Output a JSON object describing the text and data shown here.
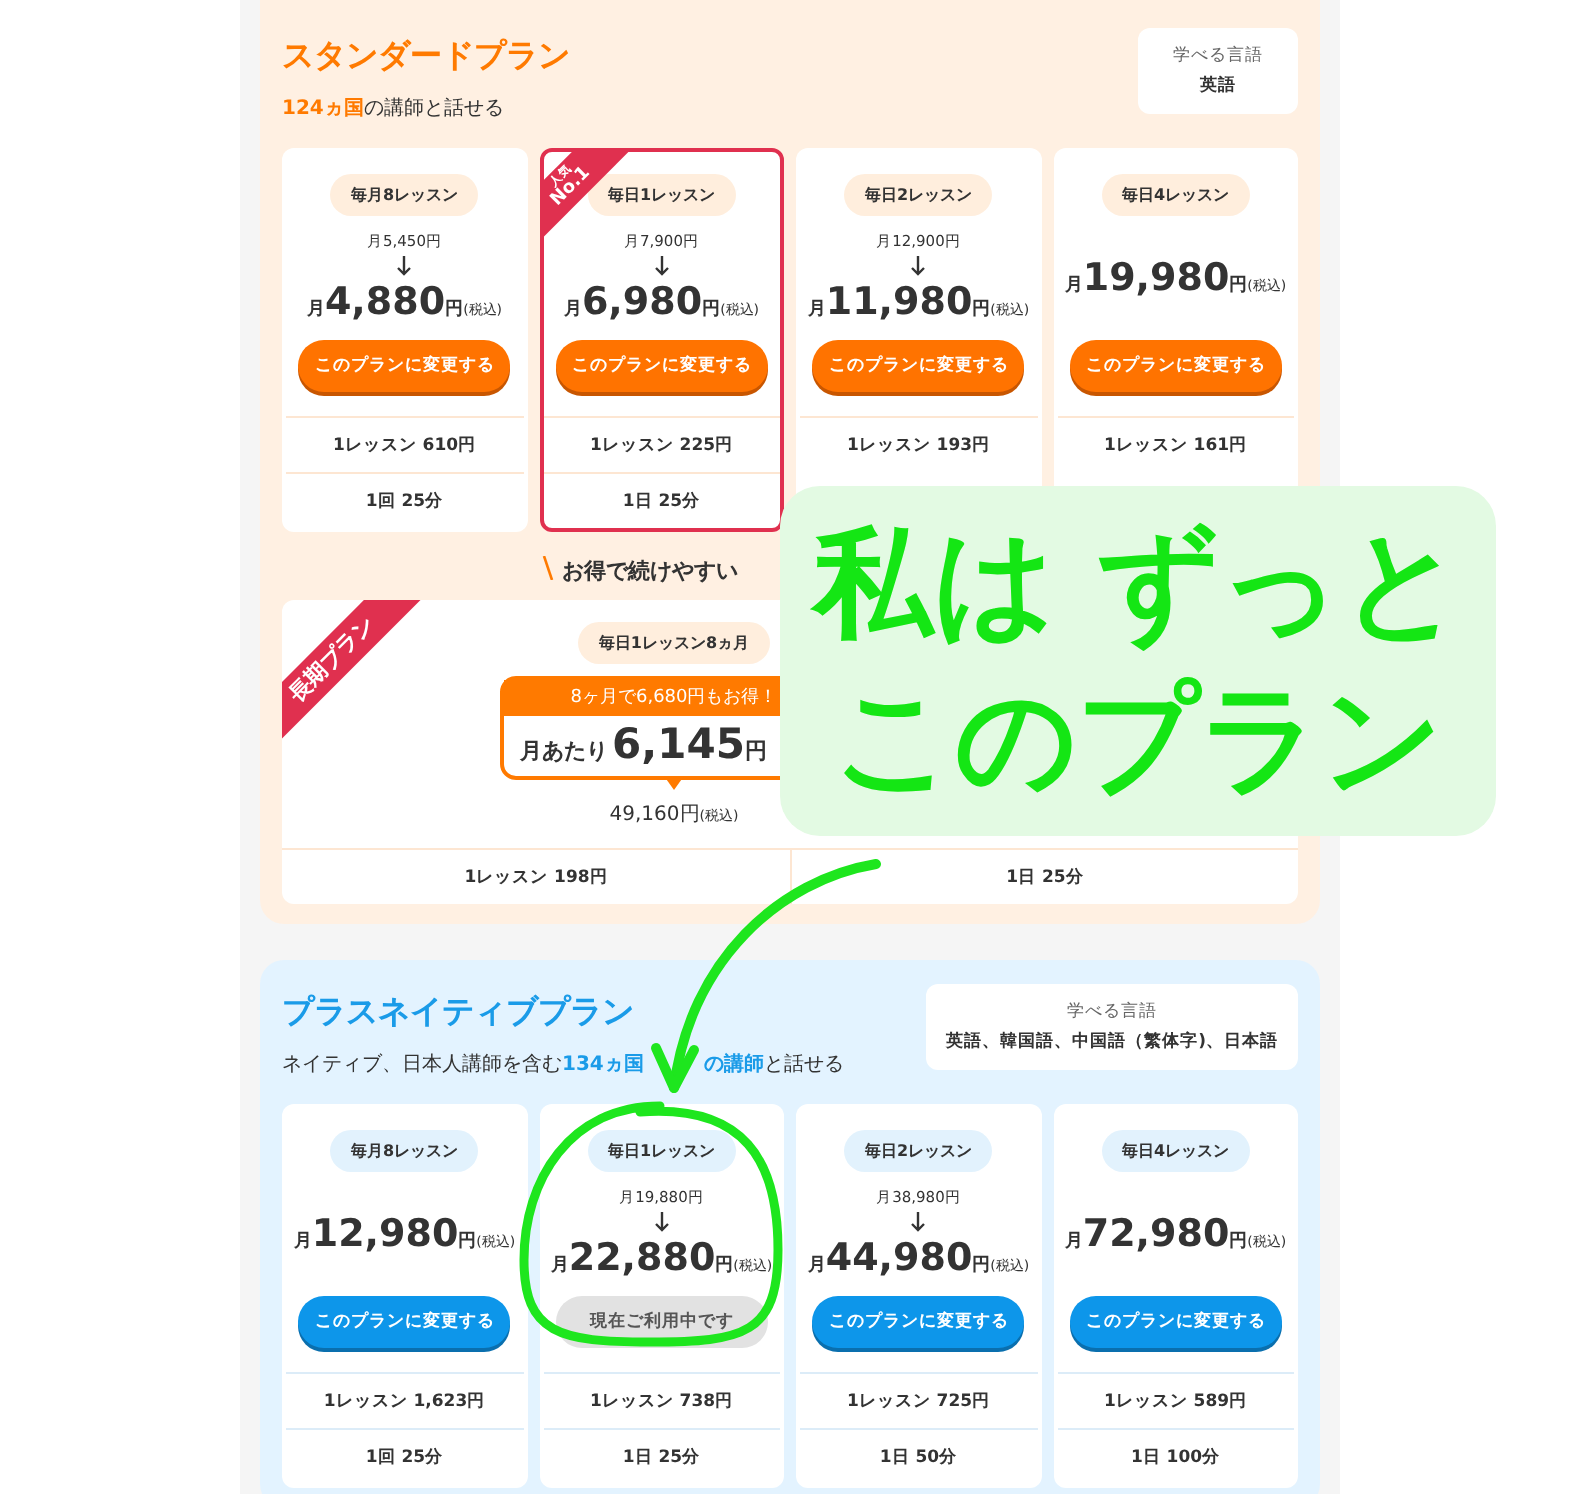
{
  "standard_plan": {
    "kind": "standard",
    "title": "スタンダードプラン",
    "subtitle": "**124ヵ国**の講師と話せる",
    "languages": {
      "label": "学べる言語",
      "value": "英語"
    },
    "plans": [
      {
        "tag": "毎月8レッスン",
        "original_price": "月5,450円",
        "prefix": "月",
        "amount": "4,880",
        "unit": "円",
        "tax": "(税込)",
        "button": "このプランに変更する",
        "current": false,
        "highlighted": false,
        "rows": [
          "1レッスン 610円",
          "1回 25分"
        ]
      },
      {
        "tag": "毎日1レッスン",
        "badge_small": "人気",
        "badge": "No.1",
        "original_price": "月7,900円",
        "prefix": "月",
        "amount": "6,980",
        "unit": "円",
        "tax": "(税込)",
        "button": "このプランに変更する",
        "current": false,
        "highlighted": true,
        "rows": [
          "1レッスン 225円",
          "1日 25分"
        ]
      },
      {
        "tag": "毎日2レッスン",
        "original_price": "月12,900円",
        "prefix": "月",
        "amount": "11,980",
        "unit": "円",
        "tax": "(税込)",
        "button": "このプランに変更する",
        "current": false,
        "highlighted": false,
        "rows": [
          "1レッスン 193円"
        ]
      },
      {
        "tag": "毎日4レッスン",
        "prefix": "月",
        "amount": "19,980",
        "unit": "円",
        "tax": "(税込)",
        "button": "このプランに変更する",
        "current": false,
        "highlighted": false,
        "rows": [
          "1レッスン 161円"
        ]
      }
    ],
    "long_term": {
      "heading": "お得で続けやすい",
      "ribbon": "長期プラン",
      "tag": "毎日1レッスン8ヵ月",
      "bubble": "8ヶ月で6,680円もお得！",
      "per_month": "月あたり",
      "amount": "6,145",
      "unit": "円",
      "total": "49,160円",
      "total_tax": "(税込)",
      "rows": [
        "1レッスン 198円",
        "1日 25分"
      ]
    }
  },
  "plus_native_plan": {
    "kind": "plus",
    "title": "プラスネイティブプラン",
    "subtitle": "ネイティブ、日本人講師を含む**134ヵ国**　　　**の講師**と話せる",
    "languages": {
      "label": "学べる言語",
      "value": "英語、韓国語、中国語（繁体字)、日本語"
    },
    "plans": [
      {
        "tag": "毎月8レッスン",
        "prefix": "月",
        "amount": "12,980",
        "unit": "円",
        "tax": "(税込)",
        "button": "このプランに変更する",
        "current": false,
        "highlighted": false,
        "rows": [
          "1レッスン 1,623円",
          "1回 25分"
        ]
      },
      {
        "tag": "毎日1レッスン",
        "original_price": "月19,880円",
        "prefix": "月",
        "amount": "22,880",
        "unit": "円",
        "tax": "(税込)",
        "button": "現在ご利用中です",
        "current": true,
        "highlighted": false,
        "rows": [
          "1レッスン 738円",
          "1日 25分"
        ]
      },
      {
        "tag": "毎日2レッスン",
        "original_price": "月38,980円",
        "prefix": "月",
        "amount": "44,980",
        "unit": "円",
        "tax": "(税込)",
        "button": "このプランに変更する",
        "current": false,
        "highlighted": false,
        "rows": [
          "1レッスン 725円",
          "1日 50分"
        ]
      },
      {
        "tag": "毎日4レッスン",
        "prefix": "月",
        "amount": "72,980",
        "unit": "円",
        "tax": "(税込)",
        "button": "このプランに変更する",
        "current": false,
        "highlighted": false,
        "rows": [
          "1レッスン 589円",
          "1日 100分"
        ]
      }
    ]
  },
  "annotation": {
    "lines": [
      "私は ずっと",
      "このプラン"
    ]
  }
}
